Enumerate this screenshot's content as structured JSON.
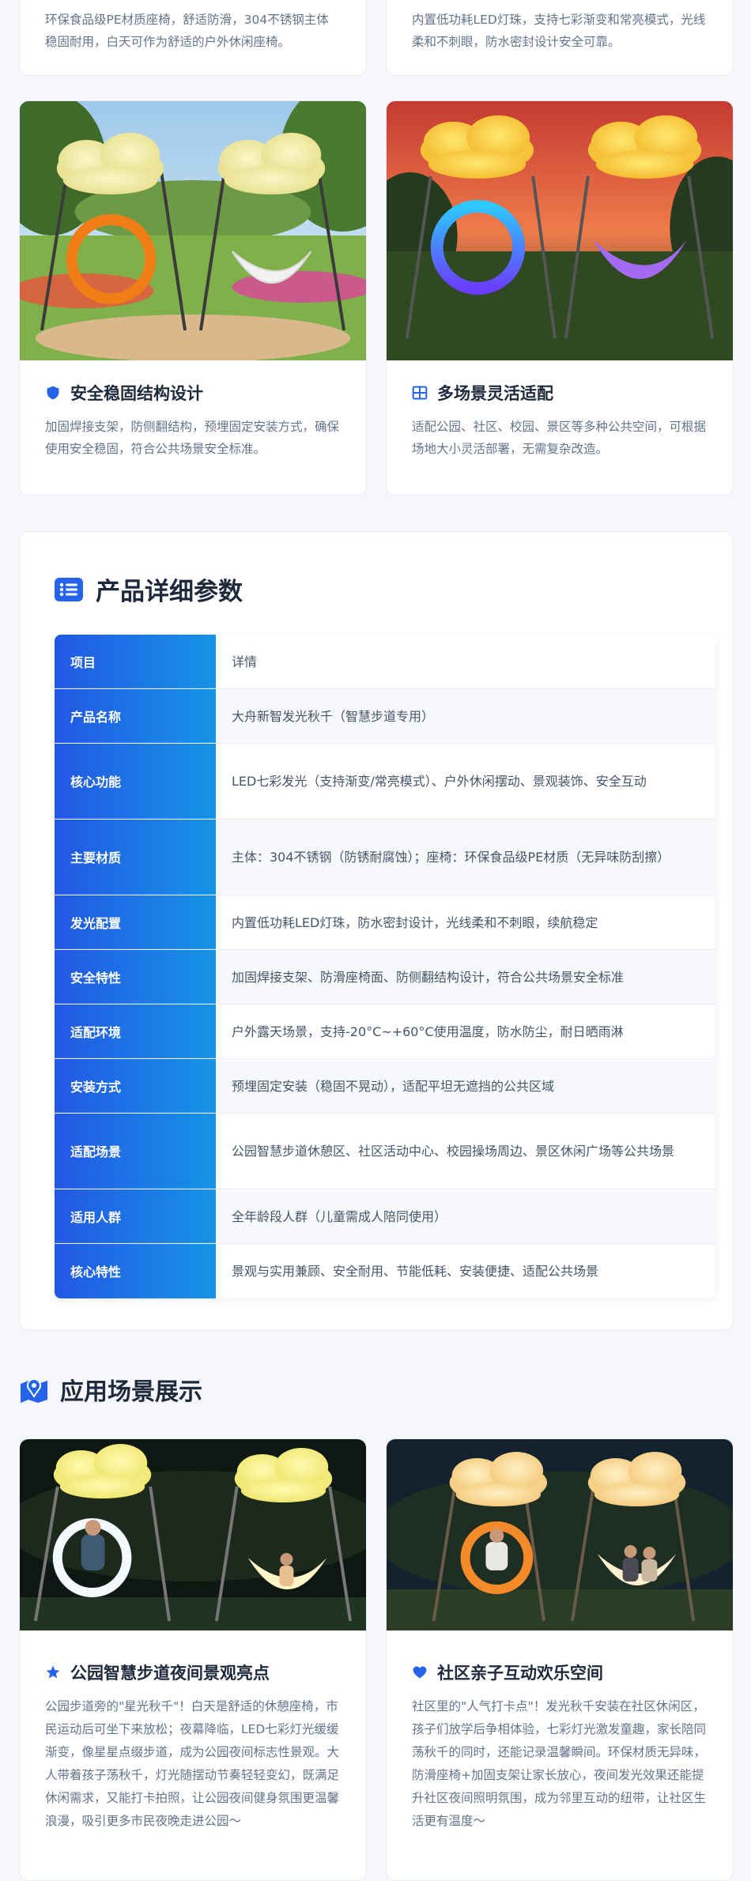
{
  "top_cards": [
    {
      "desc": "环保食品级PE材质座椅，舒适防滑，304不锈钢主体稳固耐用，白天可作为舒适的户外休闲座椅。"
    },
    {
      "desc": "内置低功耗LED灯珠，支持七彩渐变和常亮模式，光线柔和不刺眼，防水密封设计安全可靠。"
    }
  ],
  "feature_cards": [
    {
      "icon": "shield-icon",
      "title": "安全稳固结构设计",
      "desc": "加固焊接支架，防侧翻结构，预埋固定安装方式，确保使用安全稳固，符合公共场景安全标准。"
    },
    {
      "icon": "grid-icon",
      "title": "多场景灵活适配",
      "desc": "适配公园、社区、校园、景区等多种公共空间，可根据场地大小灵活部署，无需复杂改造。"
    }
  ],
  "spec": {
    "icon": "list-icon",
    "title": "产品详细参数",
    "rows": [
      {
        "k": "项目",
        "v": "详情"
      },
      {
        "k": "产品名称",
        "v": "大舟新智发光秋千（智慧步道专用）"
      },
      {
        "k": "核心功能",
        "v": "LED七彩发光（支持渐变/常亮模式）、户外休闲摆动、景观装饰、安全互动"
      },
      {
        "k": "主要材质",
        "v": "主体：304不锈钢（防锈耐腐蚀）；座椅：环保食品级PE材质（无异味防刮擦）"
      },
      {
        "k": "发光配置",
        "v": "内置低功耗LED灯珠，防水密封设计，光线柔和不刺眼，续航稳定"
      },
      {
        "k": "安全特性",
        "v": "加固焊接支架、防滑座椅面、防侧翻结构设计，符合公共场景安全标准"
      },
      {
        "k": "适配环境",
        "v": "户外露天场景，支持-20°C~+60°C使用温度，防水防尘，耐日晒雨淋"
      },
      {
        "k": "安装方式",
        "v": "预埋固定安装（稳固不晃动），适配平坦无遮挡的公共区域"
      },
      {
        "k": "适配场景",
        "v": "公园智慧步道休憩区、社区活动中心、校园操场周边、景区休闲广场等公共场景"
      },
      {
        "k": "适用人群",
        "v": "全年龄段人群（儿童需成人陪同使用）"
      },
      {
        "k": "核心特性",
        "v": "景观与实用兼顾、安全耐用、节能低耗、安装便捷、适配公共场景"
      }
    ]
  },
  "scenes": {
    "icon": "map-icon",
    "title": "应用场景展示",
    "cards": [
      {
        "icon": "star-icon",
        "title": "公园智慧步道夜间景观亮点",
        "desc": "公园步道旁的\"星光秋千\"！白天是舒适的休憩座椅，市民运动后可坐下来放松；夜幕降临，LED七彩灯光缓缓渐变，像星星点缀步道，成为公园夜间标志性景观。大人带着孩子荡秋千，灯光随摆动节奏轻轻变幻，既满足休闲需求，又能打卡拍照，让公园夜间健身氛围更温馨浪漫，吸引更多市民夜晚走进公园～"
      },
      {
        "icon": "heart-icon",
        "title": "社区亲子互动欢乐空间",
        "desc": "社区里的\"人气打卡点\"！发光秋千安装在社区休闲区，孩子们放学后争相体验，七彩灯光激发童趣，家长陪同荡秋千的同时，还能记录温馨瞬间。环保材质无异味，防滑座椅+加固支架让家长放心，夜间发光效果还能提升社区夜间照明氛围，成为邻里互动的纽带，让社区生活更有温度～"
      }
    ]
  },
  "colors": {
    "accent": "#2563eb",
    "gradient_start": "#2357e4",
    "gradient_end": "#1594e6"
  }
}
